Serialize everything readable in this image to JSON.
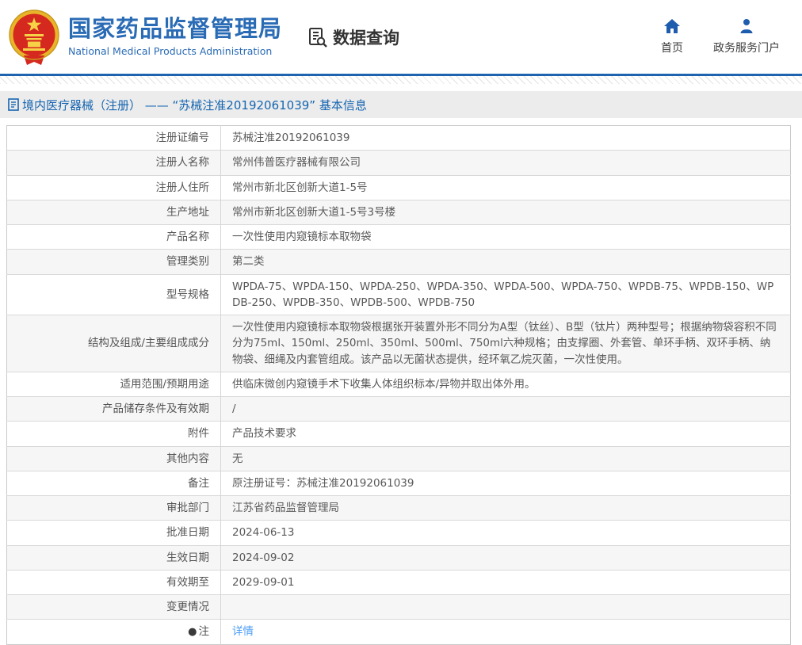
{
  "header": {
    "agency_title": "国家药品监督管理局",
    "agency_subtitle": "National Medical Products Administration",
    "section_label": "数据查询",
    "nav": {
      "home": "首页",
      "portal": "政务服务门户"
    }
  },
  "breadcrumb": {
    "text": "境内医疗器械（注册） —— “苏械注准20192061039” 基本信息"
  },
  "icons": {
    "emblem": "china-national-emblem",
    "section_icon": "document-search-icon",
    "home": "home-icon",
    "portal": "person-icon",
    "breadcrumb": "document-icon",
    "note_bullet": "●"
  },
  "colors": {
    "brand_blue": "#2a6bb5",
    "nav_icon_blue": "#1e5cae",
    "divider_blue": "#1d63ae",
    "breadcrumb_text": "#1565b0",
    "breadcrumb_bg": "#ececec",
    "link_blue": "#4a9cf5",
    "alt_row_bg": "#f6f6f6",
    "table_border": "#c9c9c9",
    "table_text": "#595959",
    "emblem_red": "#d5281e",
    "emblem_gold": "#e8b42a"
  },
  "table": {
    "rows": [
      {
        "label": "注册证编号",
        "value": "苏械注准20192061039"
      },
      {
        "label": "注册人名称",
        "value": "常州伟普医疗器械有限公司"
      },
      {
        "label": "注册人住所",
        "value": "常州市新北区创新大道1-5号"
      },
      {
        "label": "生产地址",
        "value": "常州市新北区创新大道1-5号3号楼"
      },
      {
        "label": "产品名称",
        "value": "一次性使用内窥镜标本取物袋"
      },
      {
        "label": "管理类别",
        "value": "第二类"
      },
      {
        "label": "型号规格",
        "value": "WPDA-75、WPDA-150、WPDA-250、WPDA-350、WPDA-500、WPDA-750、WPDB-75、WPDB-150、WPDB-250、WPDB-350、WPDB-500、WPDB-750"
      },
      {
        "label": "结构及组成/主要组成成分",
        "value": "一次性使用内窥镜标本取物袋根据张开装置外形不同分为A型（钛丝）、B型（钛片）两种型号；根据纳物袋容积不同分为75ml、150ml、250ml、350ml、500ml、750ml六种规格；由支撑圈、外套管、单环手柄、双环手柄、纳物袋、细绳及内套管组成。该产品以无菌状态提供，经环氧乙烷灭菌，一次性使用。"
      },
      {
        "label": "适用范围/预期用途",
        "value": "供临床微创内窥镜手术下收集人体组织标本/异物并取出体外用。"
      },
      {
        "label": "产品储存条件及有效期",
        "value": "/"
      },
      {
        "label": "附件",
        "value": "产品技术要求"
      },
      {
        "label": "其他内容",
        "value": "无"
      },
      {
        "label": "备注",
        "value": "原注册证号：苏械注准20192061039"
      },
      {
        "label": "审批部门",
        "value": "江苏省药品监督管理局"
      },
      {
        "label": "批准日期",
        "value": "2024-06-13"
      },
      {
        "label": "生效日期",
        "value": "2024-09-02"
      },
      {
        "label": "有效期至",
        "value": "2029-09-01"
      },
      {
        "label": "变更情况",
        "value": ""
      },
      {
        "label": "注",
        "value": "详情",
        "link": true,
        "bullet": true
      }
    ]
  }
}
